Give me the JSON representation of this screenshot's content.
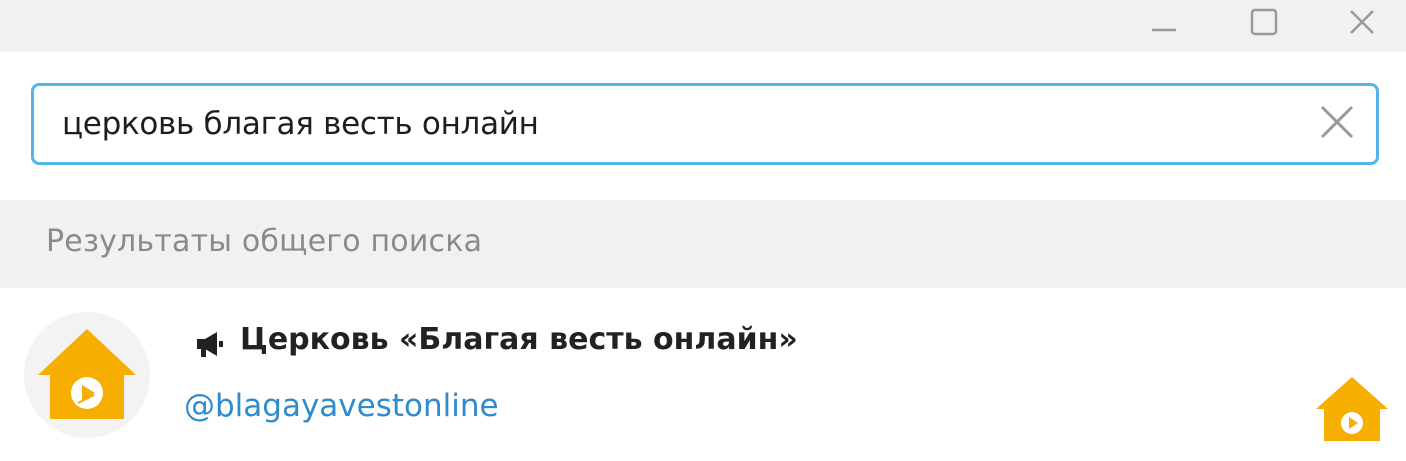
{
  "window": {
    "controls": {
      "minimize_icon": "minimize-icon",
      "maximize_icon": "maximize-icon",
      "close_icon": "close-icon"
    }
  },
  "search": {
    "value": "церковь благая весть онлайн",
    "clear_icon": "close-icon",
    "border_color": "#54b5e6"
  },
  "section": {
    "title": "Результаты общего поиска"
  },
  "results": [
    {
      "type_icon": "megaphone-icon",
      "title": "Церковь «Благая весть онлайн»",
      "username": "@blagayavestonline",
      "avatar_icon": "house-play-logo",
      "avatar_color": "#f6ae00"
    }
  ],
  "colors": {
    "accent": "#54b5e6",
    "link": "#2f8ccc",
    "logo": "#f6ae00"
  }
}
